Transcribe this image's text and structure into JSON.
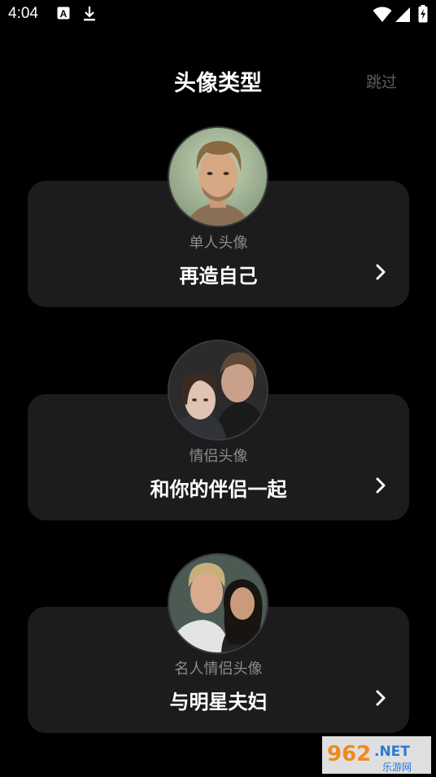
{
  "status_bar": {
    "time": "4:04",
    "icons": [
      "text-a-icon",
      "download-icon",
      "wifi-icon",
      "signal-icon",
      "battery-charging-icon"
    ]
  },
  "header": {
    "title": "头像类型",
    "skip_label": "跳过"
  },
  "cards": [
    {
      "subtitle": "单人头像",
      "title": "再造自己",
      "avatar": "single-portrait-avatar"
    },
    {
      "subtitle": "情侣头像",
      "title": "和你的伴侣一起",
      "avatar": "couple-portrait-avatar"
    },
    {
      "subtitle": "名人情侣头像",
      "title": "与明星夫妇",
      "avatar": "celebrity-couple-avatar"
    }
  ],
  "watermark": {
    "brand": "962.NET",
    "sub": "乐游网"
  },
  "colors": {
    "background": "#000000",
    "card": "#1c1c1e",
    "subtitle": "#8b8b8b",
    "skip": "#5e5e5e"
  }
}
